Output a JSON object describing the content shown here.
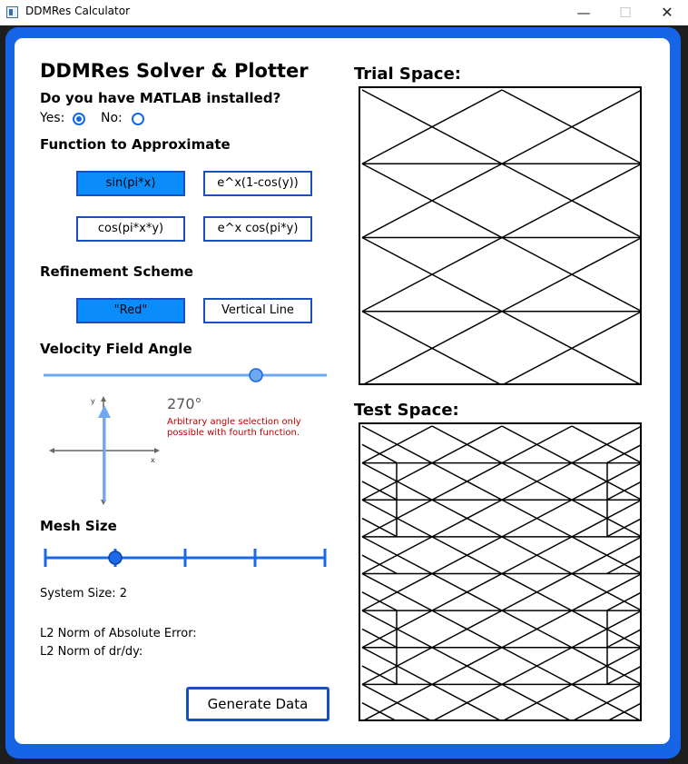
{
  "window": {
    "title": "DDMRes Calculator",
    "minimize": "—",
    "maximize": "☐",
    "close": "✕"
  },
  "left": {
    "app_title": "DDMRes Solver & Plotter",
    "matlab_question": "Do you have MATLAB installed?",
    "yes_label": "Yes:",
    "no_label": "No:",
    "matlab_selected": "Yes",
    "function_heading": "Function to Approximate",
    "functions": [
      "sin(pi*x)",
      "e^x(1-cos(y))",
      "cos(pi*x*y)",
      "e^x cos(pi*y)"
    ],
    "function_selected": "sin(pi*x)",
    "refinement_heading": "Refinement Scheme",
    "refinements": [
      "\"Red\"",
      "Vertical Line"
    ],
    "refinement_selected": "\"Red\"",
    "velocity_heading": "Velocity Field Angle",
    "velocity_slider_value": 0.75,
    "angle_readout": "270°",
    "angle_note_1": "Arbitrary angle selection only",
    "angle_note_2": "possible with fourth function.",
    "axis_y_label": "y",
    "axis_x_label": "x",
    "mesh_heading": "Mesh Size",
    "mesh_ticks": 5,
    "mesh_selected_index": 1,
    "system_size": "System Size: 2",
    "l2_abs_error": "L2 Norm of Absolute Error:",
    "l2_dr_dy": "L2 Norm of dr/dy:",
    "generate_label": "Generate Data"
  },
  "right": {
    "trial_heading": "Trial Space:",
    "test_heading": "Test Space:",
    "trial_mesh": {
      "columns": 2,
      "rows": 4
    },
    "test_mesh": {
      "columns": 4,
      "rows": 8,
      "cross_pattern": "refined"
    }
  },
  "colors": {
    "accent": "#1565e6",
    "selected_button": "#0a8dfb",
    "note": "#c00000",
    "readout": "#555555"
  }
}
